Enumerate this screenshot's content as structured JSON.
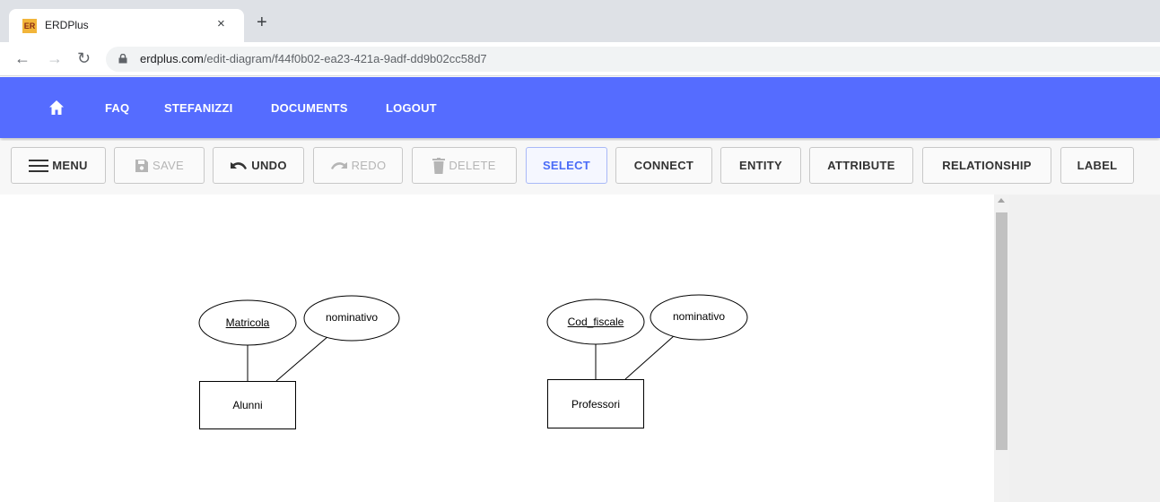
{
  "browser": {
    "favicon_text": "ER",
    "tab_title": "ERDPlus",
    "tab_close": "×",
    "new_tab": "+",
    "url_host": "erdplus.com",
    "url_path": "/edit-diagram/f44f0b02-ea23-421a-9adf-dd9b02cc58d7"
  },
  "navbar": {
    "links": [
      "FAQ",
      "STEFANIZZI",
      "DOCUMENTS",
      "LOGOUT"
    ]
  },
  "toolbar": {
    "menu": "MENU",
    "save": "SAVE",
    "undo": "UNDO",
    "redo": "REDO",
    "delete": "DELETE",
    "select": "SELECT",
    "connect": "CONNECT",
    "entity": "ENTITY",
    "attribute": "ATTRIBUTE",
    "relationship": "RELATIONSHIP",
    "label": "LABEL"
  },
  "diagram": {
    "entities": [
      {
        "name": "Alunni",
        "attributes": [
          {
            "name": "Matricola",
            "key": true
          },
          {
            "name": "nominativo",
            "key": false
          }
        ]
      },
      {
        "name": "Professori",
        "attributes": [
          {
            "name": "Cod_fiscale",
            "key": true
          },
          {
            "name": "nominativo",
            "key": false
          }
        ]
      }
    ]
  },
  "colors": {
    "navbar": "#556cff",
    "active_tool": "#4a6cf7"
  }
}
